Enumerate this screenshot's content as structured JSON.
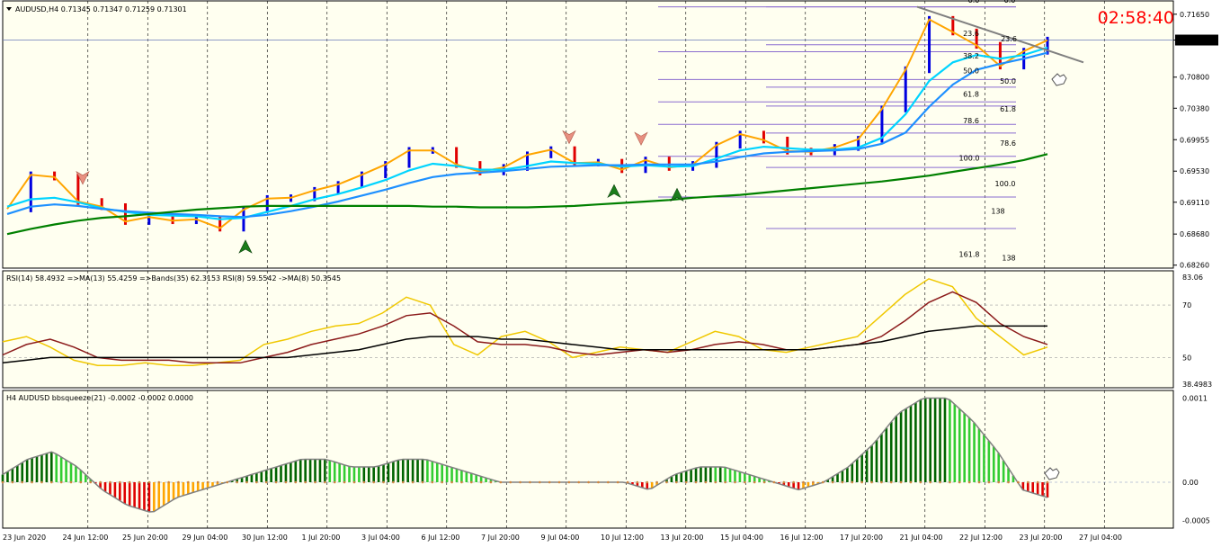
{
  "colors": {
    "background": "#fffff0",
    "bull_bar": "#0000e0",
    "bear_bar": "#e00000",
    "ma_fast": "#ffa500",
    "ma_cyan": "#00d4ff",
    "ma_blue": "#1e90ff",
    "ma_slow": "#008000",
    "ma_slow_alt": "#ff00ff",
    "fib": "#8a6ccf",
    "trendline": "#808080",
    "rsi": "#f0c800",
    "rsi_ma": "#8b1a1a",
    "bands": "#000000",
    "hist_bull_strong": "#006400",
    "hist_bull": "#32cd32",
    "hist_bear_strong": "#e00000",
    "hist_bear": "#ffa500",
    "price_line": "#6b7ab8",
    "timer": "#ff0000"
  },
  "header": {
    "symbol_info": "AUDUSD,H4  0.71345 0.71347 0.71259 0.71301",
    "timer": "02:58:40"
  },
  "chart_data": [
    {
      "type": "line",
      "title": "AUDUSD,H4",
      "ohlc": {
        "open": 0.71345,
        "high": 0.71347,
        "low": 0.71259,
        "close": 0.71301
      },
      "current_price_label": "0.71301",
      "y_tick_labels": [
        "0.71650",
        "0.71301",
        "0.70800",
        "0.70380",
        "0.69955",
        "0.69530",
        "0.69110",
        "0.68680",
        "0.68260"
      ],
      "ylim": [
        0.6822,
        0.7183
      ],
      "fib_levels": [
        "0.0",
        "0.0",
        "23.6",
        "23.6",
        "38.2",
        "50.0",
        "50.0",
        "61.8",
        "61.8",
        "78.6",
        "78.6",
        "100.0",
        "100.0",
        "138",
        "161.8",
        "138"
      ],
      "series": [
        {
          "values": [
            0.6902,
            0.6948,
            0.6945,
            0.6912,
            0.6905,
            0.6885,
            0.6891,
            0.6886,
            0.6888,
            0.6876,
            0.6901,
            0.6916,
            0.6917,
            0.6927,
            0.6935,
            0.6948,
            0.6962,
            0.6981,
            0.6981,
            0.6962,
            0.6952,
            0.6958,
            0.6975,
            0.6982,
            0.6964,
            0.6965,
            0.6955,
            0.6968,
            0.6958,
            0.6962,
            0.6988,
            0.7003,
            0.6995,
            0.698,
            0.6979,
            0.6985,
            0.6996,
            0.7037,
            0.709,
            0.7158,
            0.7141,
            0.7123,
            0.7095,
            0.7115,
            0.713
          ]
        },
        {
          "values": [
            0.6905,
            0.6915,
            0.6917,
            0.6911,
            0.6903,
            0.6898,
            0.6894,
            0.6893,
            0.6892,
            0.6888,
            0.689,
            0.6898,
            0.6906,
            0.6915,
            0.6922,
            0.6931,
            0.6941,
            0.6954,
            0.6963,
            0.696,
            0.6955,
            0.6955,
            0.696,
            0.6966,
            0.6964,
            0.6963,
            0.6959,
            0.6961,
            0.6959,
            0.696,
            0.697,
            0.6981,
            0.6986,
            0.6984,
            0.6982,
            0.6982,
            0.6985,
            0.6998,
            0.703,
            0.7075,
            0.71,
            0.711,
            0.7105,
            0.711,
            0.712
          ]
        },
        {
          "values": [
            0.6895,
            0.6905,
            0.6908,
            0.6906,
            0.6902,
            0.6899,
            0.6897,
            0.6895,
            0.6894,
            0.6892,
            0.6891,
            0.6894,
            0.6899,
            0.6905,
            0.6912,
            0.692,
            0.6928,
            0.6937,
            0.6945,
            0.6949,
            0.6951,
            0.6953,
            0.6956,
            0.6959,
            0.696,
            0.6961,
            0.6961,
            0.6962,
            0.6962,
            0.6962,
            0.6966,
            0.6972,
            0.6977,
            0.6979,
            0.698,
            0.6981,
            0.6983,
            0.699,
            0.7005,
            0.704,
            0.707,
            0.709,
            0.7098,
            0.7105,
            0.7113
          ]
        },
        {
          "values": [
            0.6868,
            0.6875,
            0.6881,
            0.6886,
            0.689,
            0.6892,
            0.6895,
            0.6898,
            0.6901,
            0.6903,
            0.6905,
            0.6906,
            0.6906,
            0.6906,
            0.6906,
            0.6906,
            0.6906,
            0.6906,
            0.6905,
            0.6905,
            0.6904,
            0.6904,
            0.6904,
            0.6905,
            0.6906,
            0.6908,
            0.691,
            0.6912,
            0.6914,
            0.6917,
            0.6919,
            0.6921,
            0.6924,
            0.6927,
            0.693,
            0.6933,
            0.6936,
            0.6939,
            0.6943,
            0.6947,
            0.6952,
            0.6957,
            0.6962,
            0.6968,
            0.6976
          ]
        }
      ]
    },
    {
      "type": "line",
      "title": "RSI(14) 58.4932  =>MA(13) 55.4259  =>Bands(35) 62.3153  RSI(8) 59.5542  ->MA(8) 50.3545",
      "y_tick_labels": [
        "83.06",
        "70",
        "50",
        "38.4983"
      ],
      "ylim": [
        38.4983,
        83.06
      ],
      "series": [
        {
          "values": [
            56,
            58,
            54,
            49,
            47,
            47,
            48,
            47,
            47,
            48,
            49,
            55,
            57,
            60,
            62,
            63,
            67,
            73,
            70,
            55,
            51,
            58,
            60,
            56,
            50,
            52,
            54,
            53,
            52,
            56,
            60,
            58,
            53,
            52,
            54,
            56,
            58,
            66,
            74,
            80,
            77,
            65,
            58,
            51,
            54
          ]
        },
        {
          "values": [
            51,
            55,
            57,
            54,
            50,
            49,
            49,
            49,
            48,
            48,
            48,
            50,
            52,
            55,
            57,
            59,
            62,
            66,
            67,
            62,
            56,
            55,
            55,
            54,
            52,
            51,
            52,
            53,
            52,
            53,
            55,
            56,
            55,
            53,
            53,
            54,
            55,
            58,
            64,
            71,
            75,
            71,
            63,
            58,
            55
          ]
        },
        {
          "values": [
            48,
            49,
            50,
            50,
            50,
            50,
            50,
            50,
            50,
            50,
            50,
            50,
            50,
            51,
            52,
            53,
            55,
            57,
            58,
            58,
            58,
            57,
            57,
            56,
            55,
            54,
            53,
            53,
            53,
            53,
            53,
            53,
            53,
            53,
            53,
            54,
            55,
            56,
            58,
            60,
            61,
            62,
            62,
            62,
            62
          ]
        }
      ]
    },
    {
      "type": "bar",
      "title": "H4 AUDUSD bbsqueeze(21) -0.0002 -0.0002 0.0000",
      "y_tick_labels": [
        "0.0011",
        "0.00",
        "-0.0005"
      ],
      "ylim": [
        -0.0006,
        0.0012
      ],
      "values": [
        0.0001,
        0.0003,
        0.0004,
        0.0002,
        -0.0001,
        -0.0003,
        -0.0004,
        -0.0002,
        -0.0001,
        0.0,
        0.0001,
        0.0002,
        0.0003,
        0.0003,
        0.0002,
        0.0002,
        0.0003,
        0.0003,
        0.0002,
        0.0001,
        0.0,
        0.0,
        0.0,
        0.0,
        0.0,
        0.0,
        -0.0001,
        0.0001,
        0.0002,
        0.0002,
        0.0001,
        0.0,
        -0.0001,
        0.0,
        0.0002,
        0.0005,
        0.0009,
        0.0011,
        0.0011,
        0.0008,
        0.0004,
        -0.0001,
        -0.0002
      ]
    }
  ],
  "time_axis": [
    "23 Jun 2020",
    "24 Jun 12:00",
    "25 Jun 20:00",
    "29 Jun 04:00",
    "30 Jun 12:00",
    "1 Jul 20:00",
    "3 Jul 04:00",
    "6 Jul 12:00",
    "7 Jul 20:00",
    "9 Jul 04:00",
    "10 Jul 12:00",
    "13 Jul 20:00",
    "15 Jul 04:00",
    "16 Jul 12:00",
    "17 Jul 20:00",
    "21 Jul 04:00",
    "22 Jul 12:00",
    "23 Jul 20:00",
    "27 Jul 04:00"
  ]
}
